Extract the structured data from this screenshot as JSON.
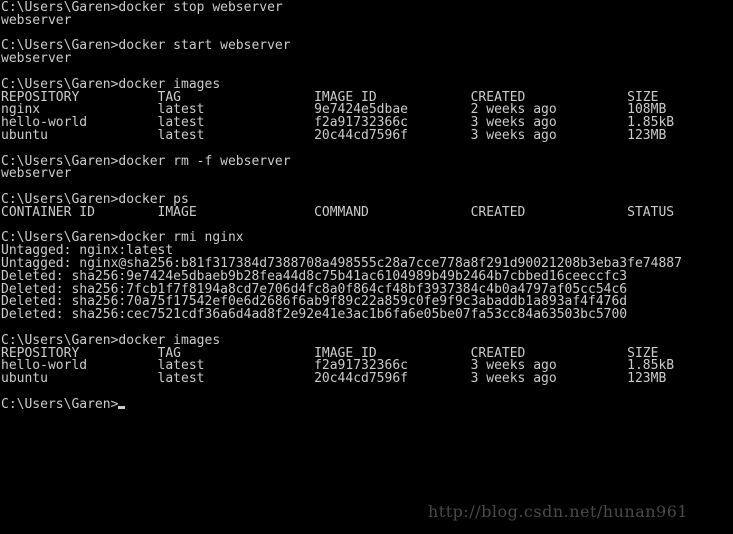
{
  "window": {
    "type": "windows-command-prompt",
    "background_color": "#000000",
    "foreground_color": "#cccccc"
  },
  "terminal": {
    "prompt": "C:\\Users\\Garen>",
    "cursor_visible": true,
    "lines": [
      "C:\\Users\\Garen>docker stop webserver",
      "webserver",
      "",
      "C:\\Users\\Garen>docker start webserver",
      "webserver",
      "",
      "C:\\Users\\Garen>docker images",
      "REPOSITORY          TAG                 IMAGE ID            CREATED             SIZE",
      "nginx               latest              9e7424e5dbae        2 weeks ago         108MB",
      "hello-world         latest              f2a91732366c        3 weeks ago         1.85kB",
      "ubuntu              latest              20c44cd7596f        3 weeks ago         123MB",
      "",
      "C:\\Users\\Garen>docker rm -f webserver",
      "webserver",
      "",
      "C:\\Users\\Garen>docker ps",
      "CONTAINER ID        IMAGE               COMMAND             CREATED             STATUS",
      "",
      "C:\\Users\\Garen>docker rmi nginx",
      "Untagged: nginx:latest",
      "Untagged: nginx@sha256:b81f317384d7388708a498555c28a7cce778a8f291d90021208b3eba3fe74887",
      "Deleted: sha256:9e7424e5dbaeb9b28fea44d8c75b41ac6104989b49b2464b7cbbed16ceeccfc3",
      "Deleted: sha256:7fcb1f7f8194a8cd7e706d4fc8a0f864cf48bf3937384c4b0a4797af05cc54c6",
      "Deleted: sha256:70a75f17542ef0e6d2686f6ab9f89c22a859c0fe9f9c3abaddb1a893af4f476d",
      "Deleted: sha256:cec7521cdf36a6d4ad8f2e92e41e3ac1b6fa6e05be07fa53cc84a63503bc5700",
      "",
      "C:\\Users\\Garen>docker images",
      "REPOSITORY          TAG                 IMAGE ID            CREATED             SIZE",
      "hello-world         latest              f2a91732366c        3 weeks ago         1.85kB",
      "ubuntu              latest              20c44cd7596f        3 weeks ago         123MB",
      ""
    ],
    "final_prompt": "C:\\Users\\Garen>"
  },
  "watermark": {
    "text": "http://blog.csdn.net/hunan961",
    "color": "#4a4a4a"
  }
}
